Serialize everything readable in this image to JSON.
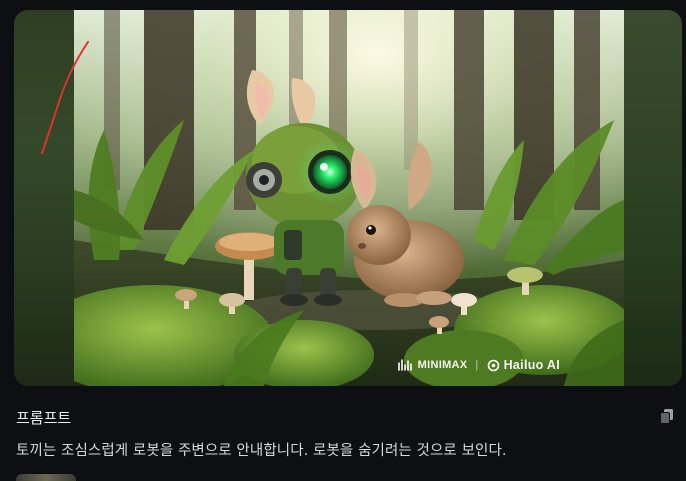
{
  "media": {
    "image_alt_icon": "generated-image",
    "watermark": {
      "brand1": "MINIMAX",
      "separator": "|",
      "brand2": "Hailuo AI"
    }
  },
  "prompt": {
    "label": "프롬프트",
    "text": "토끼는 조심스럽게 로봇을 주변으로 안내합니다. 로봇을 숨기려는 것으로 보인다.",
    "copy_icon": "copy-icon"
  },
  "colors": {
    "background": "#0d0f12",
    "robot_eye": "#2bf06a",
    "annotation": "#e0322c"
  }
}
